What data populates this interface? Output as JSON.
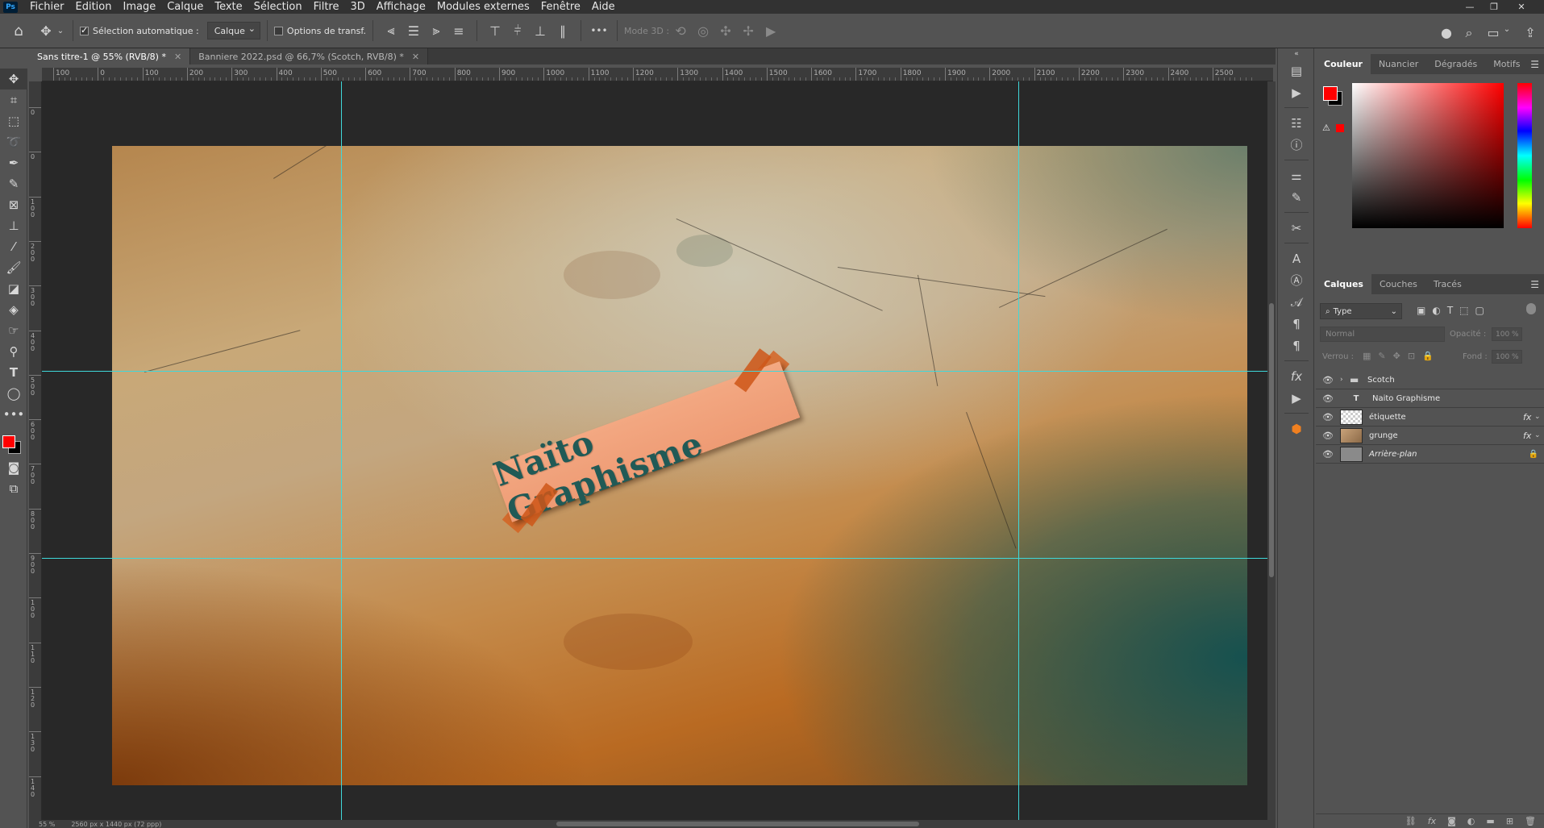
{
  "menubar": {
    "app_logo": "Ps",
    "items": [
      "Fichier",
      "Edition",
      "Image",
      "Calque",
      "Texte",
      "Sélection",
      "Filtre",
      "3D",
      "Affichage",
      "Modules externes",
      "Fenêtre",
      "Aide"
    ],
    "window_controls": [
      "minimize-icon",
      "restore-icon",
      "close-icon"
    ]
  },
  "optionsbar": {
    "auto_select_label": "Sélection automatique :",
    "auto_select_checked": true,
    "auto_select_target": "Calque",
    "transform_label": "Options de transf.",
    "transform_checked": false,
    "more_label": "•••",
    "mode3d_label": "Mode 3D :"
  },
  "tabs": [
    {
      "label": "Sans titre-1 @ 55% (RVB/8) *",
      "active": true
    },
    {
      "label": "Banniere 2022.psd @ 66,7% (Scotch, RVB/8) *",
      "active": false
    }
  ],
  "ruler_h": [
    "100",
    "0",
    "100",
    "200",
    "300",
    "400",
    "500",
    "600",
    "700",
    "800",
    "900",
    "1000",
    "1100",
    "1200",
    "1300",
    "1400",
    "1500",
    "1600",
    "1700",
    "1800",
    "1900",
    "2000",
    "2100",
    "2200",
    "2300",
    "2400",
    "2500"
  ],
  "ruler_v": [
    "0",
    "0",
    "1 0 0",
    "2 0 0",
    "3 0 0",
    "4 0 0",
    "5 0 0",
    "6 0 0",
    "7 0 0",
    "8 0 0",
    "9 0 0",
    "1 0 0",
    "1 1 0",
    "1 2 0",
    "1 3 0",
    "1 4 0"
  ],
  "canvas": {
    "label_text": "Naïto Graphisme",
    "label_color": "#215a56",
    "label_bg": "#f0a07a"
  },
  "statusbar": {
    "zoom": "55 %",
    "size": "2560 px x 1440 px (72 ppp)"
  },
  "color_panel": {
    "tabs": [
      "Couleur",
      "Nuancier",
      "Dégradés",
      "Motifs"
    ],
    "foreground": "#ff0000",
    "background": "#000000"
  },
  "layers_panel": {
    "tabs": [
      "Calques",
      "Couches",
      "Tracés"
    ],
    "filter_label": "Type",
    "blend_mode": "Normal",
    "opacity_label": "Opacité :",
    "opacity_value": "100 %",
    "lock_label": "Verrou :",
    "fill_label": "Fond :",
    "fill_value": "100 %",
    "layers": [
      {
        "name": "Scotch",
        "kind": "group",
        "fx": false
      },
      {
        "name": "Naito Graphisme",
        "kind": "text",
        "fx": false
      },
      {
        "name": "étiquette",
        "kind": "pixel",
        "fx": true
      },
      {
        "name": "grunge",
        "kind": "smart",
        "fx": true
      },
      {
        "name": "Arrière-plan",
        "kind": "background",
        "fx": false,
        "locked": true
      }
    ]
  }
}
